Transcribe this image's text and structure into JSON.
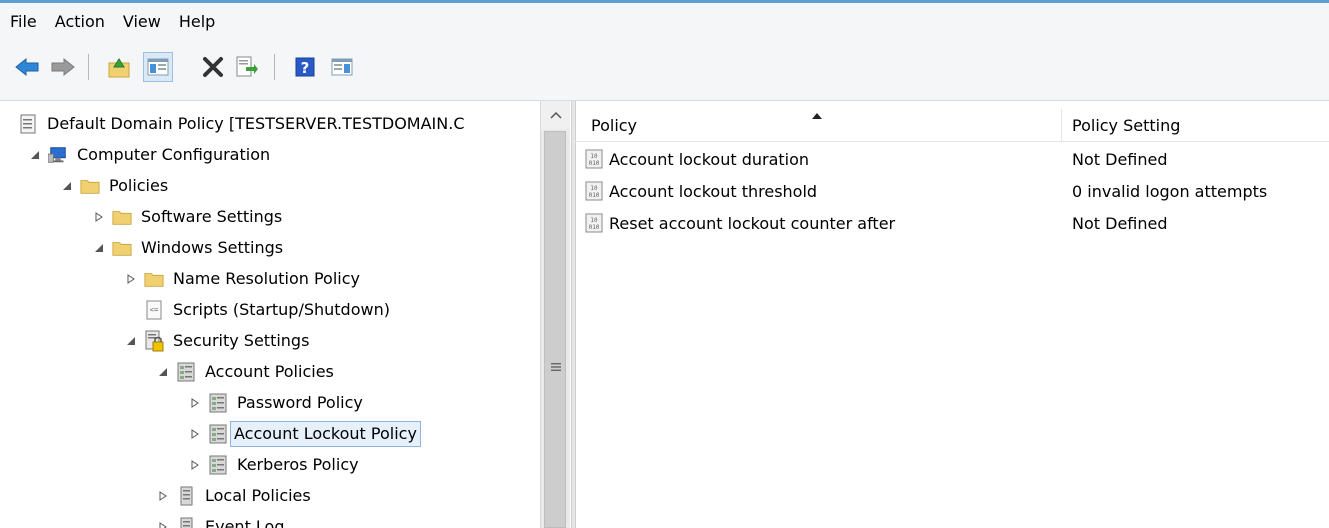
{
  "menu": [
    "File",
    "Action",
    "View",
    "Help"
  ],
  "toolbar": {
    "buttons": [
      "back-icon",
      "forward-icon",
      "up-folder-icon",
      "show-hide-tree-icon",
      "delete-icon",
      "export-list-icon",
      "help-icon",
      "show-hide-action-pane-icon"
    ]
  },
  "tree": {
    "root": "Default Domain Policy [TESTSERVER.TESTDOMAIN.C",
    "computer_configuration": "Computer Configuration",
    "policies": "Policies",
    "software_settings": "Software Settings",
    "windows_settings": "Windows Settings",
    "name_resolution_policy": "Name Resolution Policy",
    "scripts": "Scripts (Startup/Shutdown)",
    "security_settings": "Security Settings",
    "account_policies": "Account Policies",
    "password_policy": "Password Policy",
    "account_lockout_policy": "Account Lockout Policy",
    "kerberos_policy": "Kerberos Policy",
    "local_policies": "Local Policies",
    "event_log": "Event Log"
  },
  "list": {
    "columns": [
      "Policy",
      "Policy Setting"
    ],
    "sorted_column": "Policy",
    "rows": [
      {
        "policy": "Account lockout duration",
        "setting": "Not Defined"
      },
      {
        "policy": "Account lockout threshold",
        "setting": "0 invalid logon attempts"
      },
      {
        "policy": "Reset account lockout counter after",
        "setting": "Not Defined"
      }
    ]
  },
  "colors": {
    "accent_line": "#5aa0d2",
    "selection_border": "#8fb5dd",
    "selection_fill": "#e5f0fb",
    "folder": "#f0d070"
  }
}
